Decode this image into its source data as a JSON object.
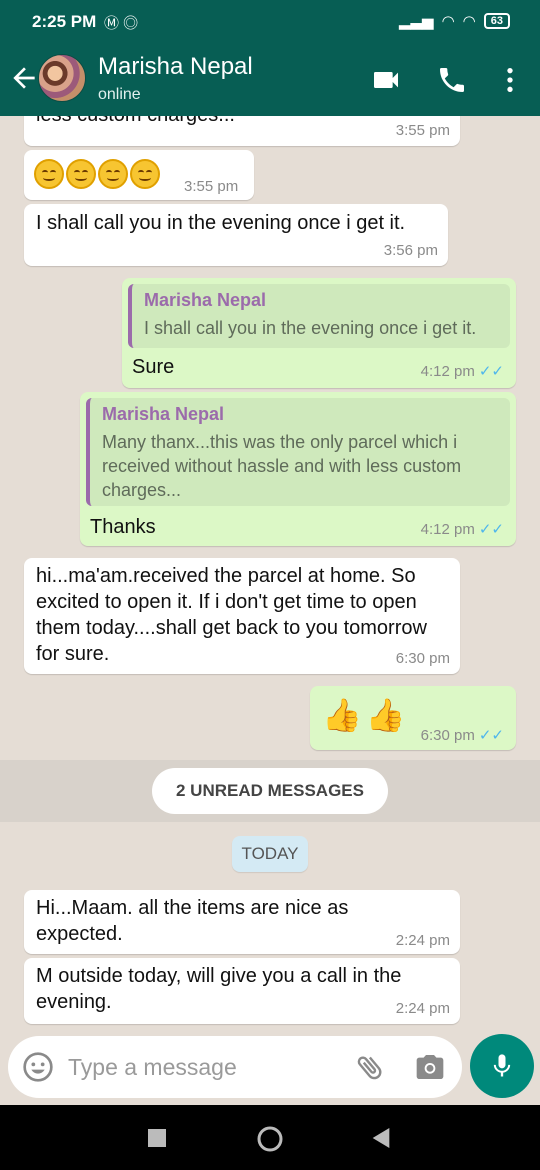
{
  "status_bar": {
    "time": "2:25 PM",
    "left_icons": "Ⓜ ◎",
    "battery": "63"
  },
  "header": {
    "contact_name": "Marisha Nepal",
    "contact_status": "online"
  },
  "messages": [
    {
      "dir": "in",
      "text": "less custom charges...",
      "time": "3:55 pm"
    },
    {
      "dir": "in",
      "type": "emoji",
      "emoji": "smiling-face x4",
      "time": "3:55 pm"
    },
    {
      "dir": "in",
      "text": "I shall call you in the evening once i get it.",
      "time": "3:56 pm"
    },
    {
      "dir": "out",
      "quote_name": "Marisha Nepal",
      "quote_text": "I shall call you in the evening once i get it.",
      "text": "Sure",
      "time": "4:12 pm",
      "ticks": "✓✓"
    },
    {
      "dir": "out",
      "quote_name": "Marisha Nepal",
      "quote_text": "Many thanx...this was the only parcel which i received without hassle and with less custom charges...",
      "text": "Thanks",
      "time": "4:12 pm",
      "ticks": "✓✓"
    },
    {
      "dir": "in",
      "text": "hi...ma'am.received the parcel at home. So excited to open it. If i don't get time to open them today....shall get back to you tomorrow for sure.",
      "time": "6:30 pm"
    },
    {
      "dir": "out",
      "type": "emoji",
      "emoji": "thumbs-up x2",
      "time": "6:30 pm",
      "ticks": "✓✓"
    },
    {
      "dir": "in",
      "text": "Hi...Maam. all the items are nice as expected.",
      "time": "2:24 pm"
    },
    {
      "dir": "in",
      "text": "M outside today, will give you a call in the evening.",
      "time": "2:24 pm"
    }
  ],
  "unread_label": "2 UNREAD MESSAGES",
  "date_label": "TODAY",
  "input": {
    "placeholder": "Type a message"
  },
  "colors": {
    "header": "#075e54",
    "outgoing": "#dcf8c6",
    "incoming": "#ffffff",
    "background": "#e5ddd5",
    "accent": "#00897b"
  }
}
